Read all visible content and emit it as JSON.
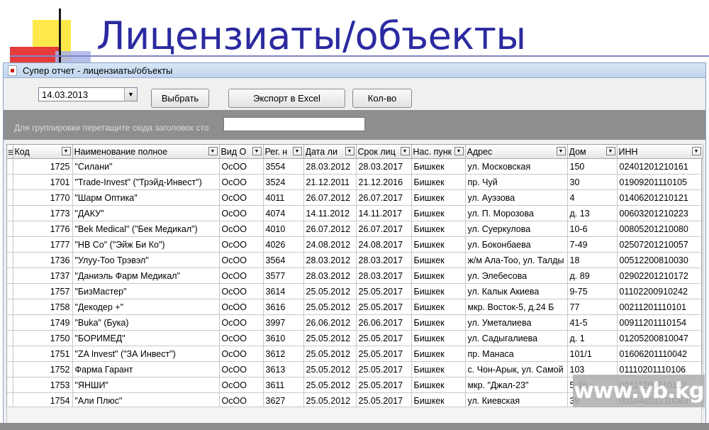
{
  "slide": {
    "title": "Лицензиаты/объекты"
  },
  "window": {
    "title": "Супер отчет - лицензиаты/объекты"
  },
  "toolbar": {
    "date": "14.03.2013",
    "select_label": "Выбрать",
    "export_label": "Экспорт в Excel",
    "count_label": "Кол-во"
  },
  "group_hint": "Для группировки перетащите сюда заголовок сто",
  "table": {
    "columns": [
      "Код",
      "Наименование полное",
      "Вид О",
      "Рег. н",
      "Дата ли",
      "Срок лиц",
      "Нас. пунк",
      "Адрес",
      "Дом",
      "ИНН"
    ],
    "rows": [
      [
        "1725",
        "\"Силани\"",
        "ОсОО",
        "3554",
        "28.03.2012",
        "28.03.2017",
        "Бишкек",
        "ул. Московская",
        "150",
        "02401201210161"
      ],
      [
        "1701",
        "\"Trade-Invest\" (\"Трэйд-Инвест\")",
        "ОсОО",
        "3524",
        "21.12.2011",
        "21.12.2016",
        "Бишкек",
        "пр. Чуй",
        "30",
        "01909201110105"
      ],
      [
        "1770",
        "\"Шарм Оптика\"",
        "ОсОО",
        "4011",
        "26.07.2012",
        "26.07.2017",
        "Бишкек",
        "ул. Ауэзова",
        "4",
        "01406201210121"
      ],
      [
        "1773",
        "\"ДАКУ\"",
        "ОсОО",
        "4074",
        "14.11.2012",
        "14.11.2017",
        "Бишкек",
        "ул. П. Морозова",
        "д. 13",
        "00603201210223"
      ],
      [
        "1776",
        "\"Bek Medical\" (\"Бек Медикал\")",
        "ОсОО",
        "4010",
        "26.07.2012",
        "26.07.2017",
        "Бишкек",
        "ул. Суеркулова",
        "10-6",
        "00805201210080"
      ],
      [
        "1777",
        "\"НВ Co\" (\"Эйж Би Ко\")",
        "ОсОО",
        "4026",
        "24.08.2012",
        "24.08.2017",
        "Бишкек",
        "ул. Боконбаева",
        "7-49",
        "02507201210057"
      ],
      [
        "1736",
        "\"Улуу-Тоо Трэвэл\"",
        "ОсОО",
        "3564",
        "28.03.2012",
        "28.03.2017",
        "Бишкек",
        "ж/м Ала-Тоо, ул. Талды",
        "18",
        "00512200810030"
      ],
      [
        "1737",
        "\"Даниэль Фарм Медикал\"",
        "ОсОО",
        "3577",
        "28.03.2012",
        "28.03.2017",
        "Бишкек",
        "ул. Элебесова",
        "д. 89",
        "02902201210172"
      ],
      [
        "1757",
        "\"БизМастер\"",
        "ОсОО",
        "3614",
        "25.05.2012",
        "25.05.2017",
        "Бишкек",
        "ул. Калык Акиева",
        "9-75",
        "01102200910242"
      ],
      [
        "1758",
        "\"Декодер +\"",
        "ОсОО",
        "3616",
        "25.05.2012",
        "25.05.2017",
        "Бишкек",
        "мкр. Восток-5, д.24 Б",
        "77",
        "00211201110101"
      ],
      [
        "1749",
        "\"Buka\" (Бука)",
        "ОсОО",
        "3997",
        "26.06.2012",
        "26.06.2017",
        "Бишкек",
        "ул. Уметалиева",
        "41-5",
        "00911201110154"
      ],
      [
        "1750",
        "\"БОРИМЕД\"",
        "ОсОО",
        "3610",
        "25.05.2012",
        "25.05.2017",
        "Бишкек",
        "ул. Садыгалиева",
        "д. 1",
        "01205200810047"
      ],
      [
        "1751",
        "\"ZA Invest\" (\"ЗА Инвест\")",
        "ОсОО",
        "3612",
        "25.05.2012",
        "25.05.2017",
        "Бишкек",
        "пр. Манаса",
        "101/1",
        "01606201110042"
      ],
      [
        "1752",
        "Фарма Гарант",
        "ОсОО",
        "3613",
        "25.05.2012",
        "25.05.2017",
        "Бишкек",
        "с. Чон-Арык, ул. Самой",
        "103",
        "01110201110106"
      ],
      [
        "1753",
        "\"ЯНШИ\"",
        "ОсОО",
        "3611",
        "25.05.2012",
        "25.05.2017",
        "Бишкек",
        "мкр. \"Джал-23\"",
        "5-36",
        "00111200710113"
      ],
      [
        "1754",
        "\"Али Плюс\"",
        "ОсОО",
        "3627",
        "25.05.2012",
        "25.05.2017",
        "Бишкек",
        "ул. Киевская",
        "39",
        "00104201210083"
      ]
    ]
  },
  "watermark": "www.vb.kg"
}
